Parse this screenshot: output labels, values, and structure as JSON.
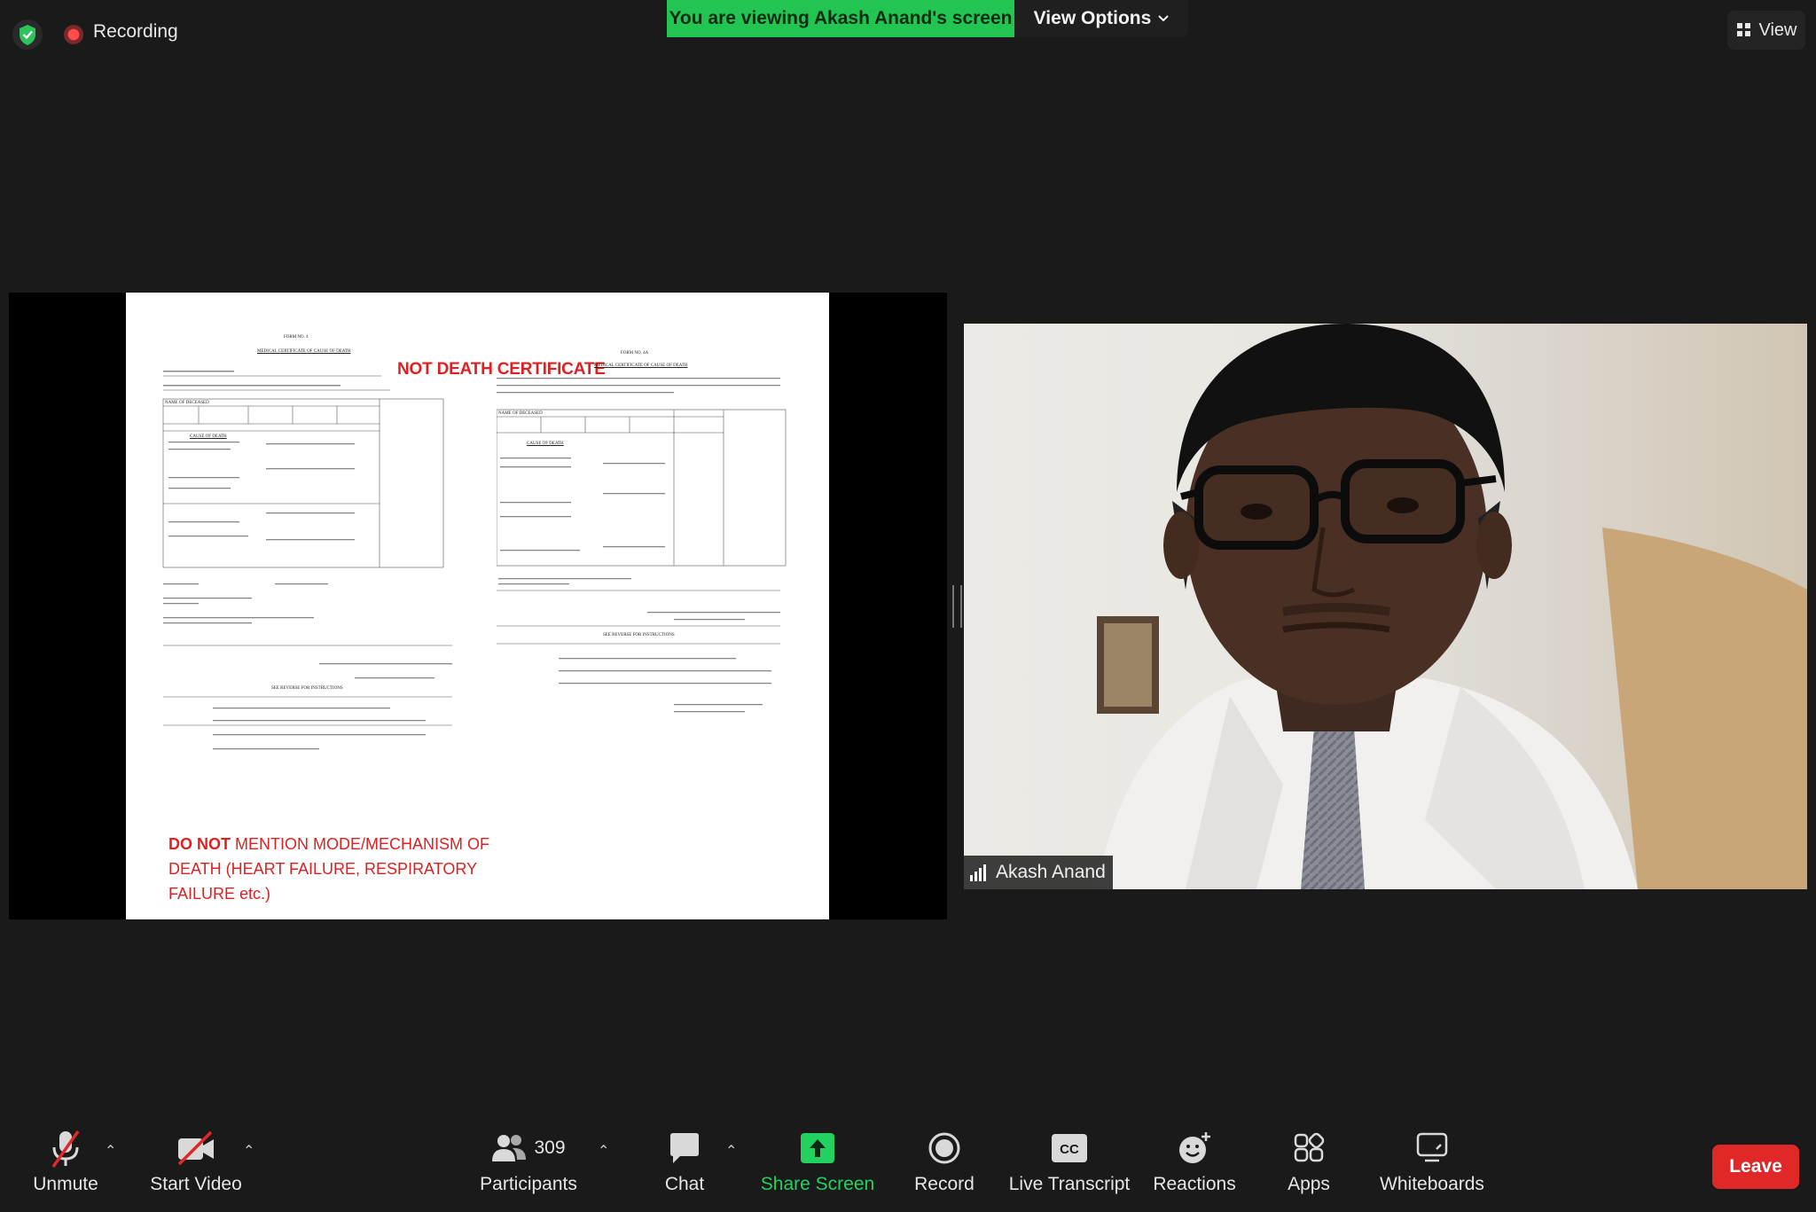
{
  "top_bar": {
    "recording_label": "Recording",
    "viewing_banner": "You are viewing Akash Anand's screen",
    "view_options_label": "View Options",
    "view_label": "View"
  },
  "slide": {
    "not_death_certificate": "NOT DEATH CERTIFICATE",
    "do_not_prefix": "DO NOT",
    "do_not_text": " MENTION MODE/MECHANISM OF DEATH (HEART FAILURE, RESPIRATORY FAILURE etc.)",
    "form_left_title": "FORM NO. 4",
    "form_left_subtitle": "MEDICAL CERTIFICATE OF CAUSE OF DEATH",
    "form_right_title": "FORM NO. 4A",
    "form_right_subtitle": "MEDICAL CERTIFICATE OF CAUSE OF DEATH",
    "name_of_deceased": "NAME OF DECEASED",
    "cause_of_death": "CAUSE OF DEATH",
    "see_reverse": "SEE REVERSE FOR INSTRUCTIONS"
  },
  "participant": {
    "name": "Akash Anand"
  },
  "toolbar": {
    "unmute": "Unmute",
    "start_video": "Start Video",
    "participants_count": "309",
    "participants": "Participants",
    "chat": "Chat",
    "share_screen": "Share Screen",
    "record": "Record",
    "live_transcript": "Live Transcript",
    "reactions": "Reactions",
    "apps": "Apps",
    "whiteboards": "Whiteboards",
    "leave": "Leave"
  },
  "colors": {
    "banner_green": "#23c552",
    "share_green": "#23d160",
    "leave_red": "#e02828",
    "slide_red": "#e02020"
  }
}
